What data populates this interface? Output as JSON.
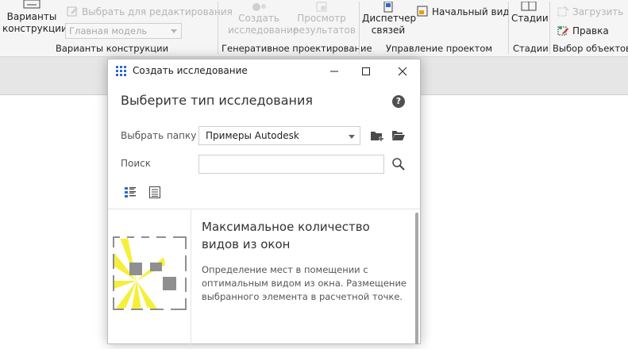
{
  "ribbon": {
    "variants_button": "Варианты\nконструкции",
    "select_for_edit": "Выбрать для редактирования",
    "main_model": "Главная модель",
    "group_variants": "Варианты конструкции",
    "create_study": "Создать\nисследование",
    "view_results": "Просмотр\nрезультатов",
    "group_generative": "Генеративное проектирование",
    "dispatcher_links": "Диспетчер\nсвязей",
    "start_view": "Начальный вид",
    "group_project": "Управление проектом",
    "stages": "Стадии",
    "group_stages": "Стадии",
    "load": "Загрузить",
    "edit": "Правка",
    "group_selection": "Выбор объектов"
  },
  "dialog": {
    "title": "Создать исследование",
    "heading": "Выберите тип исследования",
    "help_glyph": "?",
    "folder_label": "Выбрать папку",
    "folder_value": "Примеры Autodesk",
    "search_label": "Поиск",
    "search_value": ""
  },
  "study_item": {
    "title": "Максимальное количество видов из окон",
    "description": "Определение мест в помещении с оптимальным видом из окна. Размещение выбранного элемента в расчетной точке."
  },
  "colors": {
    "accent": "#2a6bc4",
    "ray_yellow": "#f6ef3a",
    "thumb_gray": "#8f8f8f"
  }
}
